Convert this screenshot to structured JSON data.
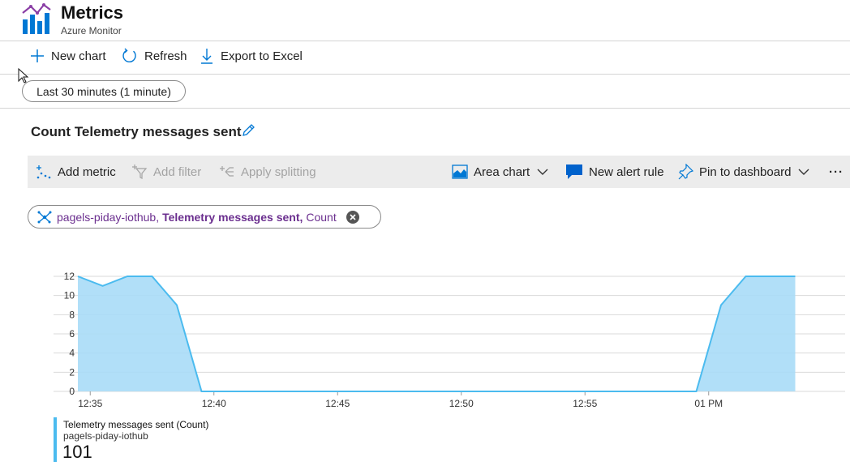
{
  "header": {
    "title": "Metrics",
    "subtitle": "Azure Monitor",
    "logo_icon": "metrics-bar-chart-icon"
  },
  "commands": [
    {
      "label": "New chart",
      "icon": "plus-icon"
    },
    {
      "label": "Refresh",
      "icon": "refresh-icon"
    },
    {
      "label": "Export to Excel",
      "icon": "download-icon"
    }
  ],
  "time_range": {
    "label": "Last 30 minutes (1 minute)"
  },
  "chart_title": "Count Telemetry messages sent",
  "toolbar": {
    "add_metric": "Add metric",
    "add_filter": "Add filter",
    "apply_splitting": "Apply splitting",
    "chart_type": "Area chart",
    "new_alert": "New alert rule",
    "pin": "Pin to dashboard",
    "more": "···"
  },
  "metric_pill": {
    "resource": "pagels-piday-iothub,",
    "metric": "Telemetry messages sent,",
    "aggregation": "Count"
  },
  "legend": {
    "name": "Telemetry messages sent (Count)",
    "resource": "pagels-piday-iothub",
    "total": "101"
  },
  "colors": {
    "accent": "#0078d4",
    "series_fill": "#a8dcf7",
    "series_line": "#4bbbef",
    "metric_purple": "#6b2f8f"
  },
  "chart_data": {
    "type": "area",
    "x": [
      0,
      1,
      2,
      3,
      4,
      5,
      6,
      7,
      8,
      9,
      10,
      11,
      12,
      13,
      14,
      15,
      16,
      17,
      18,
      19,
      20,
      21,
      22,
      23,
      24,
      25,
      26,
      27,
      28,
      29
    ],
    "series": [
      {
        "name": "Telemetry messages sent (Count)",
        "values": [
          12,
          11,
          12,
          12,
          9,
          0,
          0,
          0,
          0,
          0,
          0,
          0,
          0,
          0,
          0,
          0,
          0,
          0,
          0,
          0,
          0,
          0,
          0,
          0,
          0,
          0,
          9,
          12,
          12,
          12
        ]
      }
    ],
    "xtick_labels": [
      "12:35",
      "12:40",
      "12:45",
      "12:50",
      "12:55",
      "01 PM"
    ],
    "xtick_positions": [
      0.5,
      5.5,
      10.5,
      15.5,
      20.5,
      25.5
    ],
    "yticks": [
      0,
      2,
      4,
      6,
      8,
      10,
      12
    ],
    "ylim": [
      0,
      12
    ],
    "grid": true
  }
}
